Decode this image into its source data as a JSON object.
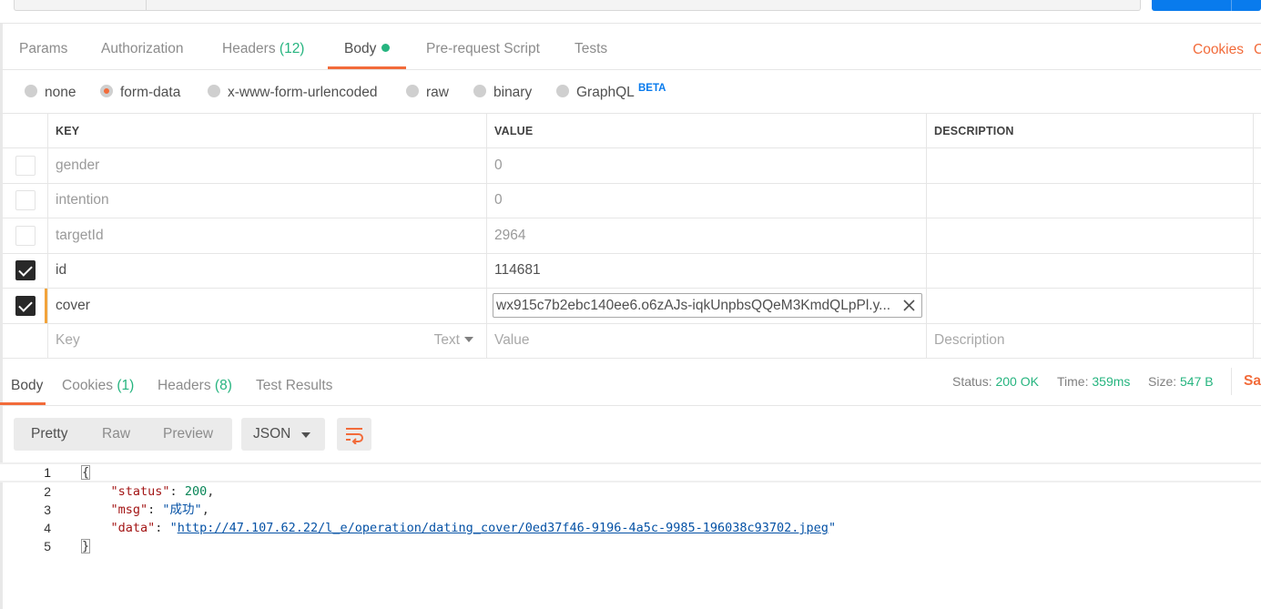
{
  "request_tabs": {
    "params": "Params",
    "authorization": "Authorization",
    "headers": "Headers",
    "headers_count": "(12)",
    "body": "Body",
    "pre_request": "Pre-request Script",
    "tests": "Tests",
    "cookies": "Cookies",
    "code": "C"
  },
  "body_types": {
    "none": "none",
    "form_data": "form-data",
    "urlencoded": "x-www-form-urlencoded",
    "raw": "raw",
    "binary": "binary",
    "graphql": "GraphQL",
    "beta": "BETA",
    "selected": "form-data"
  },
  "table": {
    "headers": {
      "key": "KEY",
      "value": "VALUE",
      "description": "DESCRIPTION"
    },
    "rows": [
      {
        "key": "gender",
        "value": "0",
        "enabled": false
      },
      {
        "key": "intention",
        "value": "0",
        "enabled": false
      },
      {
        "key": "targetId",
        "value": "2964",
        "enabled": false
      },
      {
        "key": "id",
        "value": "114681",
        "enabled": true
      },
      {
        "key": "cover",
        "value": "wx915c7b2ebc140ee6.o6zAJs-iqkUnpbsQQeM3KmdQLpPl.y...",
        "enabled": true
      }
    ],
    "new_row": {
      "key_placeholder": "Key",
      "type": "Text",
      "value_placeholder": "Value",
      "description_placeholder": "Description"
    }
  },
  "response_tabs": {
    "body": "Body",
    "cookies": "Cookies",
    "cookies_count": "(1)",
    "headers": "Headers",
    "headers_count": "(8)",
    "test_results": "Test Results"
  },
  "status": {
    "status_label": "Status:",
    "status_value": "200 OK",
    "time_label": "Time:",
    "time_value": "359ms",
    "size_label": "Size:",
    "size_value": "547 B",
    "save": "Sav"
  },
  "view_modes": {
    "pretty": "Pretty",
    "raw": "Raw",
    "preview": "Preview",
    "language": "JSON"
  },
  "response_body": {
    "line_numbers": [
      "1",
      "2",
      "3",
      "4",
      "5"
    ],
    "open_brace": "{",
    "close_brace": "}",
    "status_key": "\"status\"",
    "status_value": "200",
    "msg_key": "\"msg\"",
    "msg_value": "\"成功\"",
    "data_key": "\"data\"",
    "data_value": "http://47.107.62.22/l_e/operation/dating_cover/0ed37f46-9196-4a5c-9985-196038c93702.jpeg"
  },
  "colors": {
    "accent": "#f26b3a",
    "success": "#26b47f",
    "link": "#097bed"
  },
  "icons": {
    "clear": "close-icon",
    "wrap": "wrap-lines-icon",
    "dropdown": "chevron-down-icon"
  }
}
